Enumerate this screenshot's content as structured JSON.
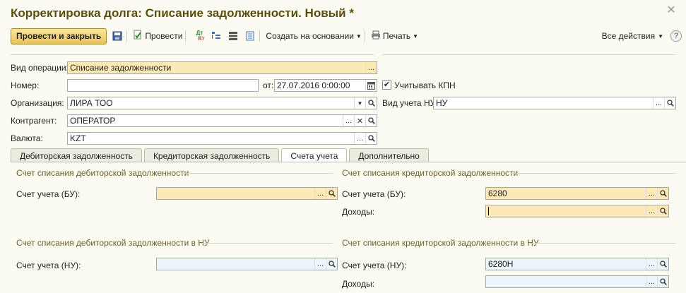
{
  "window": {
    "title": "Корректировка долга: Списание задолженности. Новый *"
  },
  "toolbar": {
    "post_close": "Провести и закрыть",
    "post": "Провести",
    "create_based": "Создать на основании",
    "print": "Печать",
    "all_actions": "Все действия",
    "help": "?",
    "dt_kt_top": "Дт",
    "dt_kt_bottom": "Кт"
  },
  "form": {
    "operation_label": "Вид операции:",
    "operation_value": "Списание задолженности",
    "number_label": "Номер:",
    "number_value": "",
    "date_label": "от:",
    "date_value": "27.07.2016  0:00:00",
    "kpn_label": "Учитывать КПН",
    "kpn_checked": true,
    "org_label": "Организация:",
    "org_value": "ЛИРА ТОО",
    "tax_type_label": "Вид учета НУ:",
    "tax_type_value": "НУ",
    "counterparty_label": "Контрагент:",
    "counterparty_value": "ОПЕРАТОР",
    "currency_label": "Валюта:",
    "currency_value": "KZT"
  },
  "tabs": [
    {
      "label": "Дебиторская задолженность",
      "active": false
    },
    {
      "label": "Кредиторская задолженность",
      "active": false
    },
    {
      "label": "Счета учета",
      "active": true
    },
    {
      "label": "Дополнительно",
      "active": false
    }
  ],
  "accounts": {
    "deb_group": "Счет списания дебиторской задолженности",
    "deb_bu_label": "Счет учета (БУ):",
    "deb_bu_value": "",
    "cred_group": "Счет списания кредиторской задолженности",
    "cred_bu_label": "Счет учета (БУ):",
    "cred_bu_value": "6280",
    "cred_income_label": "Доходы:",
    "cred_income_value": "",
    "deb_nu_group": "Счет списания дебиторской задолженности в НУ",
    "deb_nu_label": "Счет учета (НУ):",
    "deb_nu_value": "",
    "cred_nu_group": "Счет списания кредиторской задолженности в НУ",
    "cred_nu_label": "Счет учета (НУ):",
    "cred_nu_value": "6280Н",
    "cred_nu_income_label": "Доходы:",
    "cred_nu_income_value": ""
  },
  "field_buttons": {
    "ellipsis": "...",
    "clear": "✕",
    "dropdown": "▼"
  },
  "colors": {
    "title": "#5b4e0f",
    "required_field": "#fde9b6",
    "tax_field": "#eaf6fb",
    "primary_button": "#e9c25b"
  }
}
